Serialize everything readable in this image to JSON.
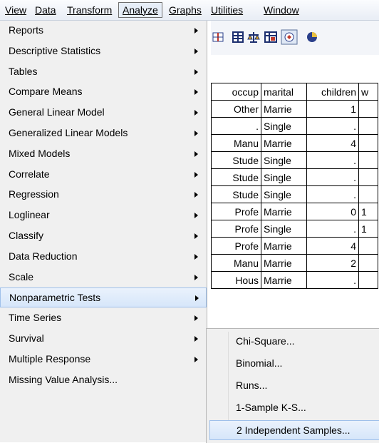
{
  "menubar": {
    "items": [
      "View",
      "Data",
      "Transform",
      "Analyze",
      "Graphs",
      "Utilities",
      "Window"
    ],
    "active": "Analyze"
  },
  "analyze_menu": {
    "items": [
      {
        "label": "Reports",
        "submenu": true
      },
      {
        "label": "Descriptive Statistics",
        "submenu": true
      },
      {
        "label": "Tables",
        "submenu": true
      },
      {
        "label": "Compare Means",
        "submenu": true
      },
      {
        "label": "General Linear Model",
        "submenu": true
      },
      {
        "label": "Generalized Linear Models",
        "submenu": true
      },
      {
        "label": "Mixed Models",
        "submenu": true
      },
      {
        "label": "Correlate",
        "submenu": true
      },
      {
        "label": "Regression",
        "submenu": true
      },
      {
        "label": "Loglinear",
        "submenu": true
      },
      {
        "label": "Classify",
        "submenu": true
      },
      {
        "label": "Data Reduction",
        "submenu": true
      },
      {
        "label": "Scale",
        "submenu": true
      },
      {
        "label": "Nonparametric Tests",
        "submenu": true
      },
      {
        "label": "Time Series",
        "submenu": true
      },
      {
        "label": "Survival",
        "submenu": true
      },
      {
        "label": "Multiple Response",
        "submenu": true
      },
      {
        "label": "Missing Value Analysis...",
        "submenu": false
      }
    ],
    "highlighted": "Nonparametric Tests"
  },
  "nonparametric_submenu": {
    "items": [
      "Chi-Square...",
      "Binomial...",
      "Runs...",
      "1-Sample K-S...",
      "2 Independent Samples..."
    ],
    "highlighted": "2 Independent Samples..."
  },
  "data_grid": {
    "columns": [
      "occup",
      "marital",
      "children",
      "w"
    ],
    "rows": [
      [
        "Other",
        "Marrie",
        "1",
        ""
      ],
      [
        ".",
        "Single",
        ".",
        ""
      ],
      [
        "Manu",
        "Marrie",
        "4",
        ""
      ],
      [
        "Stude",
        "Single",
        ".",
        ""
      ],
      [
        "Stude",
        "Single",
        ".",
        ""
      ],
      [
        "Stude",
        "Single",
        ".",
        ""
      ],
      [
        "Profe",
        "Marrie",
        "0",
        "1"
      ],
      [
        "Profe",
        "Single",
        ".",
        "1"
      ],
      [
        "Profe",
        "Marrie",
        "4",
        ""
      ],
      [
        "Manu",
        "Marrie",
        "2",
        ""
      ],
      [
        "Hous",
        "Marrie",
        ".",
        ""
      ]
    ]
  },
  "toolbar": {
    "icons": [
      "split-file-icon",
      "select-cases-icon",
      "weight-cases-icon",
      "value-labels-icon",
      "use-sets-icon",
      "pie-icon"
    ]
  }
}
